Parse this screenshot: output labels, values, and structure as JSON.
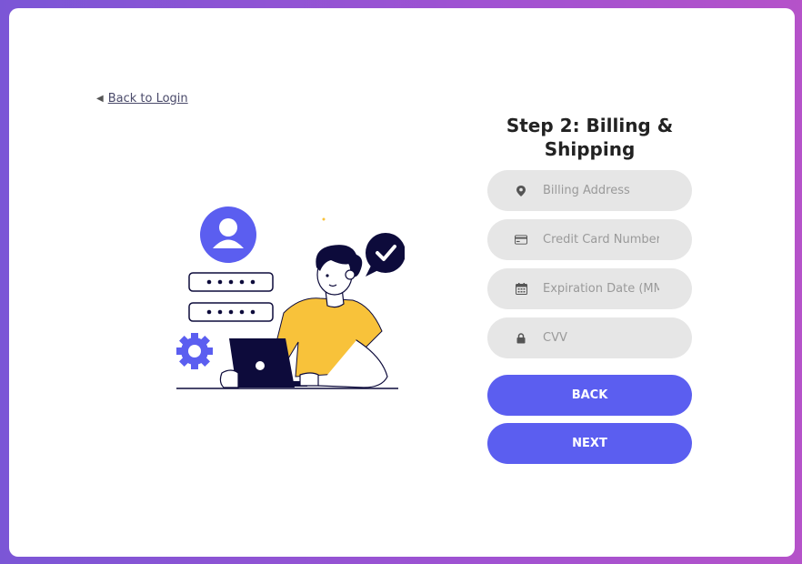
{
  "back_link": {
    "arrow": "◀",
    "label": "Back to Login"
  },
  "form": {
    "title": "Step 2: Billing & Shipping",
    "fields": [
      {
        "placeholder": "Billing Address",
        "icon": "location-pin-icon"
      },
      {
        "placeholder": "Credit Card Number",
        "icon": "credit-card-icon"
      },
      {
        "placeholder": "Expiration Date (MM/YY)",
        "icon": "calendar-icon"
      },
      {
        "placeholder": "CVV",
        "icon": "lock-icon"
      }
    ],
    "back_label": "BACK",
    "next_label": "NEXT"
  },
  "colors": {
    "accent": "#5b5ef0",
    "field_bg": "#e6e6e6",
    "shirt": "#f8c23a",
    "navy": "#0d0b3b"
  }
}
